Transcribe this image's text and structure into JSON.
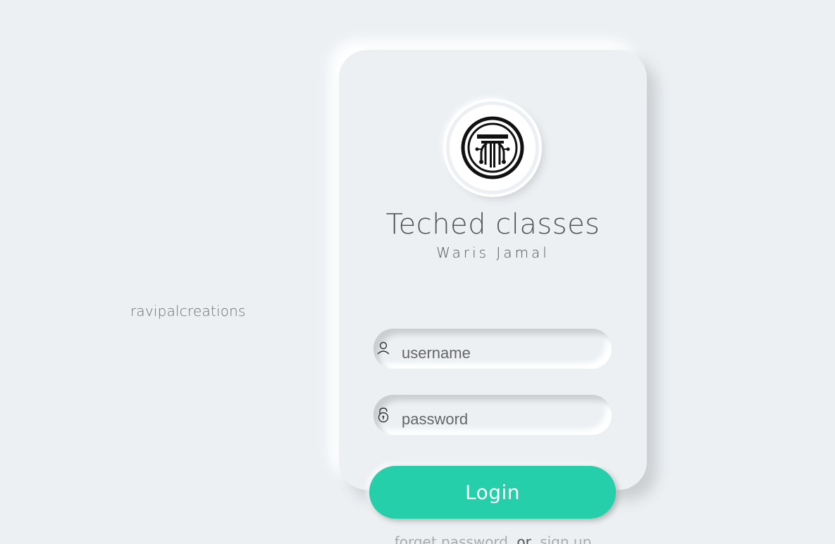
{
  "watermark": "ravipalcreations",
  "brand": {
    "title": "Teched classes",
    "subtitle": "Waris Jamal",
    "logo_icon": "teched-logo-icon"
  },
  "form": {
    "username_placeholder": "username",
    "password_placeholder": "password",
    "username_icon": "user-icon",
    "password_icon": "lock-icon",
    "login_label": "Login"
  },
  "footer": {
    "forgot_label": "forget password",
    "or_label": "or",
    "signup_label": "sign up"
  },
  "colors": {
    "background": "#ecf0f3",
    "accent": "#24cfaa"
  }
}
